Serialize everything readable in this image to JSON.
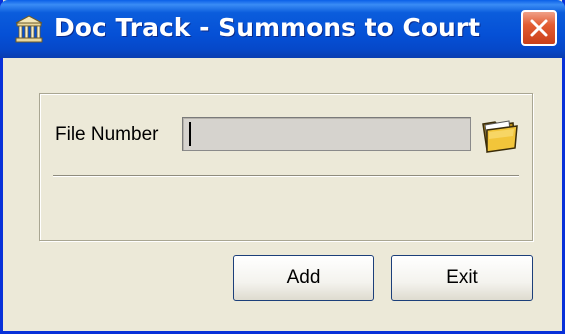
{
  "window": {
    "title": "Doc Track - Summons to Court",
    "app_icon": "courthouse-icon",
    "close_icon": "close-icon"
  },
  "form": {
    "file_number_label": "File Number",
    "file_number_value": "",
    "browse_icon": "folder-icon"
  },
  "buttons": {
    "add_label": "Add",
    "exit_label": "Exit"
  },
  "colors": {
    "titlebar": "#0550d6",
    "window_bg": "#ece9d8",
    "input_bg": "#d6d3ce",
    "close_button": "#e35d33"
  }
}
